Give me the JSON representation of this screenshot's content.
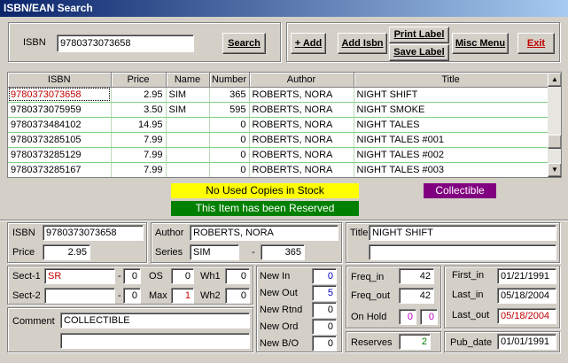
{
  "window": {
    "title": "ISBN/EAN Search"
  },
  "search": {
    "label": "ISBN",
    "value": "9780373073658",
    "button": "Search"
  },
  "toolbar": {
    "add": "+ Add",
    "add_isbn": "Add Isbn",
    "print_label": "Print Label",
    "save_label": "Save Label",
    "misc_menu": "Misc Menu",
    "exit": "Exit"
  },
  "grid": {
    "columns": [
      "ISBN",
      "Price",
      "Name",
      "Number",
      "Author",
      "Title"
    ],
    "rows": [
      [
        "9780373073658",
        "2.95",
        "SIM",
        "365",
        "ROBERTS, NORA",
        "NIGHT SHIFT"
      ],
      [
        "9780373075959",
        "3.50",
        "SIM",
        "595",
        "ROBERTS, NORA",
        "NIGHT SMOKE"
      ],
      [
        "9780373484102",
        "14.95",
        "",
        "0",
        "ROBERTS, NORA",
        "NIGHT TALES"
      ],
      [
        "9780373285105",
        "7.99",
        "",
        "0",
        "ROBERTS, NORA",
        "NIGHT TALES #001"
      ],
      [
        "9780373285129",
        "7.99",
        "",
        "0",
        "ROBERTS, NORA",
        "NIGHT TALES #002"
      ],
      [
        "9780373285167",
        "7.99",
        "",
        "0",
        "ROBERTS, NORA",
        "NIGHT TALES #003"
      ]
    ]
  },
  "banners": {
    "no_used": "No Used Copies in Stock",
    "reserved": "This Item has been Reserved",
    "collectible": "Collectible"
  },
  "detail": {
    "isbn_label": "ISBN",
    "isbn": "9780373073658",
    "price_label": "Price",
    "price": "2.95",
    "author_label": "Author",
    "author": "ROBERTS, NORA",
    "series_label": "Series",
    "series": "SIM",
    "series_dash": "-",
    "series_number": "365",
    "title_label": "Title",
    "title": "NIGHT SHIFT",
    "title2": ""
  },
  "sections": {
    "sect1_label": "Sect-1",
    "sect1": "SR",
    "sect1_qty": "0",
    "sect2_label": "Sect-2",
    "sect2": "",
    "sect2_qty": "0",
    "dash": "-",
    "os_label": "OS",
    "os": "0",
    "max_label": "Max",
    "max": "1",
    "wh1_label": "Wh1",
    "wh1": "0",
    "wh2_label": "Wh2",
    "wh2": "0"
  },
  "comment": {
    "label": "Comment",
    "line1": "COLLECTIBLE",
    "line2": ""
  },
  "new_counts": {
    "new_in_label": "New In",
    "new_in": "0",
    "new_out_label": "New Out",
    "new_out": "5",
    "new_rtnd_label": "New Rtnd",
    "new_rtnd": "0",
    "new_ord_label": "New Ord",
    "new_ord": "0",
    "new_bo_label": "New B/O",
    "new_bo": "0"
  },
  "freq": {
    "freq_in_label": "Freq_in",
    "freq_in": "42",
    "freq_out_label": "Freq_out",
    "freq_out": "42",
    "on_hold_label": "On Hold",
    "on_hold_a": "0",
    "on_hold_b": "0",
    "reserves_label": "Reserves",
    "reserves": "2"
  },
  "dates": {
    "first_in_label": "First_in",
    "first_in": "01/21/1991",
    "last_in_label": "Last_in",
    "last_in": "05/18/2004",
    "last_out_label": "Last_out",
    "last_out": "05/18/2004",
    "pub_date_label": "Pub_date",
    "pub_date": "01/01/1991"
  },
  "colors": {
    "banner_yellow": "#ffff00",
    "banner_green": "#008000",
    "banner_purple": "#800080",
    "red_text": "#c00000",
    "blue_text": "#0000c0",
    "magenta_text": "#c000c0",
    "green_text": "#008000"
  }
}
